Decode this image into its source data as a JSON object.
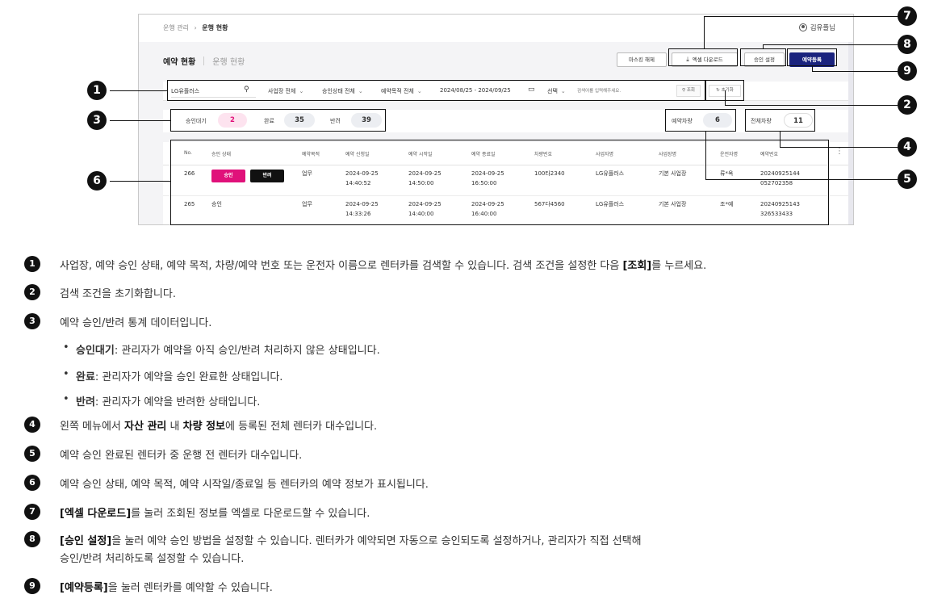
{
  "screen": {
    "breadcrumb_parent": "운행 관리",
    "breadcrumb_sep": "›",
    "breadcrumb_current": "운행 현황",
    "user_name": "김유플님",
    "tab_active": "예약 현황",
    "tab_inactive": "운행 현황",
    "buttons": {
      "master_release": "마스킹 해제",
      "excel_download": "엑셀 다운로드",
      "approval_settings": "승인 설정",
      "reserve": "예약등록"
    },
    "filter": {
      "search_value": "LG유플러스",
      "workplace": "사업장 전체",
      "approval_state": "승인상태 전체",
      "purpose": "예약목적 전체",
      "date_range": "2024/08/25 - 2024/09/25",
      "select": "선택",
      "keyword_placeholder": "검색어를 입력해주세요.",
      "query": "조회",
      "reset": "초기화"
    },
    "stats": {
      "pending_label": "승인대기",
      "pending_value": "2",
      "done_label": "완료",
      "done_value": "35",
      "rejected_label": "반려",
      "rejected_value": "39",
      "reserved_label": "예약차량",
      "reserved_value": "6",
      "total_label": "전체차량",
      "total_value": "11"
    },
    "table": {
      "headers": [
        "No.",
        "승인 상태",
        "예약목적",
        "예약 신청일",
        "예약 시작일",
        "예약 종료일",
        "차량번호",
        "사업자명",
        "사업장명",
        "운전자명",
        "예약번호"
      ],
      "rows": [
        {
          "no": "266",
          "approve_btn": "승인",
          "reject_btn": "반려",
          "purpose": "업무",
          "apply_date": "2024-09-25",
          "apply_time": "14:40:52",
          "start_date": "2024-09-25",
          "start_time": "14:50:00",
          "end_date": "2024-09-25",
          "end_time": "16:50:00",
          "plate": "100타2340",
          "company": "LG유플러스",
          "site": "기본 사업장",
          "driver": "류*옥",
          "res_no_1": "20240925144",
          "res_no_2": "052702358"
        },
        {
          "no": "265",
          "status": "승인",
          "purpose": "업무",
          "apply_date": "2024-09-25",
          "apply_time": "14:33:26",
          "start_date": "2024-09-25",
          "start_time": "14:40:00",
          "end_date": "2024-09-25",
          "end_time": "16:40:00",
          "plate": "567다4560",
          "company": "LG유플러스",
          "site": "기본 사업장",
          "driver": "조*예",
          "res_no_1": "20240925143",
          "res_no_2": "326533433"
        }
      ]
    }
  },
  "markers": [
    "1",
    "2",
    "3",
    "4",
    "5",
    "6",
    "7",
    "8",
    "9"
  ],
  "legend": {
    "l1_a": "사업장, 예약 승인 상태, 예약 목적, 차량/예약 번호 또는 운전자 이름으로 렌터카를 검색할 수 있습니다. 검색 조건을 설정한 다음 ",
    "l1_b": "[조회]",
    "l1_c": "를 누르세요.",
    "l2": "검색 조건을 초기화합니다.",
    "l3": "예약 승인/반려 통계 데이터입니다.",
    "s1_b": "승인대기",
    "s1_t": ": 관리자가 예약을 아직 승인/반려 처리하지 않은 상태입니다.",
    "s2_b": "완료",
    "s2_t": ": 관리자가 예약을 승인 완료한 상태입니다.",
    "s3_b": "반려",
    "s3_t": ": 관리자가 예약을 반려한 상태입니다.",
    "bullet": "•",
    "l4_a": "왼쪽 메뉴에서 ",
    "l4_b": "자산 관리",
    "l4_c": " 내 ",
    "l4_d": "차량 정보",
    "l4_e": "에 등록된 전체 렌터카 대수입니다.",
    "l5": "예약 승인 완료된 렌터카 중 운행 전 렌터카 대수입니다.",
    "l6": "예약 승인 상태, 예약 목적, 예약 시작일/종료일 등 렌터카의 예약 정보가 표시됩니다.",
    "l7_b": "[엑셀 다운로드]",
    "l7_t": "를 눌러 조회된 정보를 엑셀로 다운로드할 수 있습니다.",
    "l8_b": "[승인 설정]",
    "l8_t": "을 눌러 예약 승인 방법을 설정할 수 있습니다. 렌터카가 예약되면 자동으로 승인되도록 설정하거나, 관리자가 직접 선택해",
    "l8_t2": "승인/반려 처리하도록 설정할 수 있습니다.",
    "l9_b": "[예약등록]",
    "l9_t": "을 눌러 렌터카를 예약할 수 있습니다."
  },
  "colors": {
    "primary": "#1a237e",
    "pink": "#e0117a",
    "black": "#111111"
  }
}
